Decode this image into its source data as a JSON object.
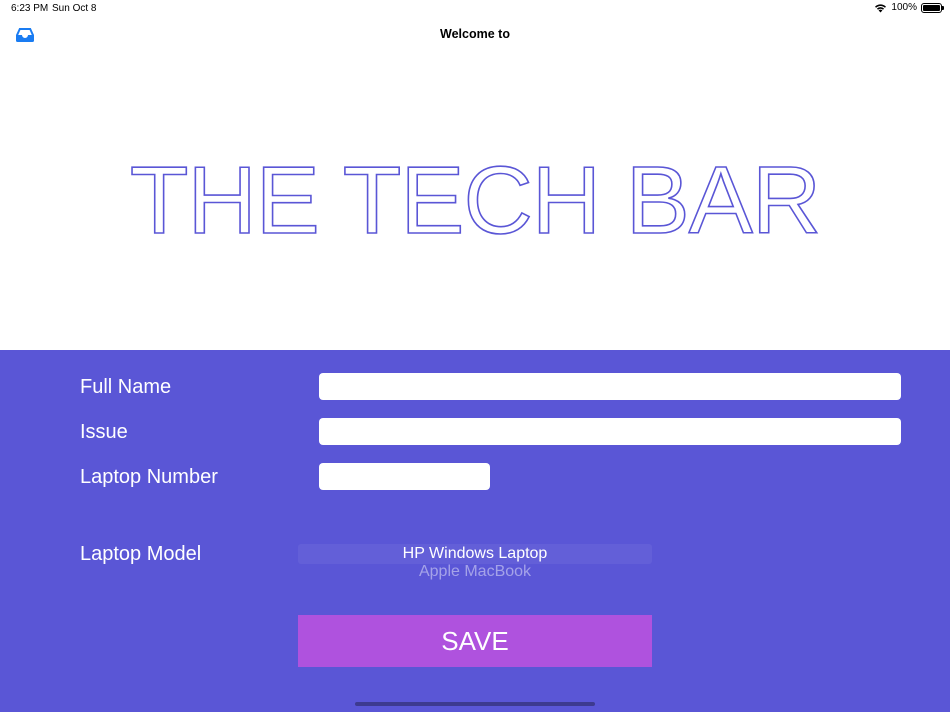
{
  "status_bar": {
    "time": "6:23 PM",
    "date": "Sun Oct 8",
    "battery": "100%"
  },
  "nav": {
    "title": "Welcome to",
    "left_icon": "inbox-tray-icon"
  },
  "hero": {
    "title": "THE TECH BAR"
  },
  "form": {
    "full_name": {
      "label": "Full Name",
      "value": ""
    },
    "issue": {
      "label": "Issue",
      "value": ""
    },
    "laptop_number": {
      "label": "Laptop Number",
      "value": ""
    },
    "laptop_model": {
      "label": "Laptop Model",
      "selected": "HP Windows Laptop",
      "next_option": "Apple MacBook"
    },
    "save_label": "SAVE"
  },
  "colors": {
    "brand": "#5a56d6",
    "save_button": "#af52de",
    "nav_icon": "#1a7cf2"
  }
}
